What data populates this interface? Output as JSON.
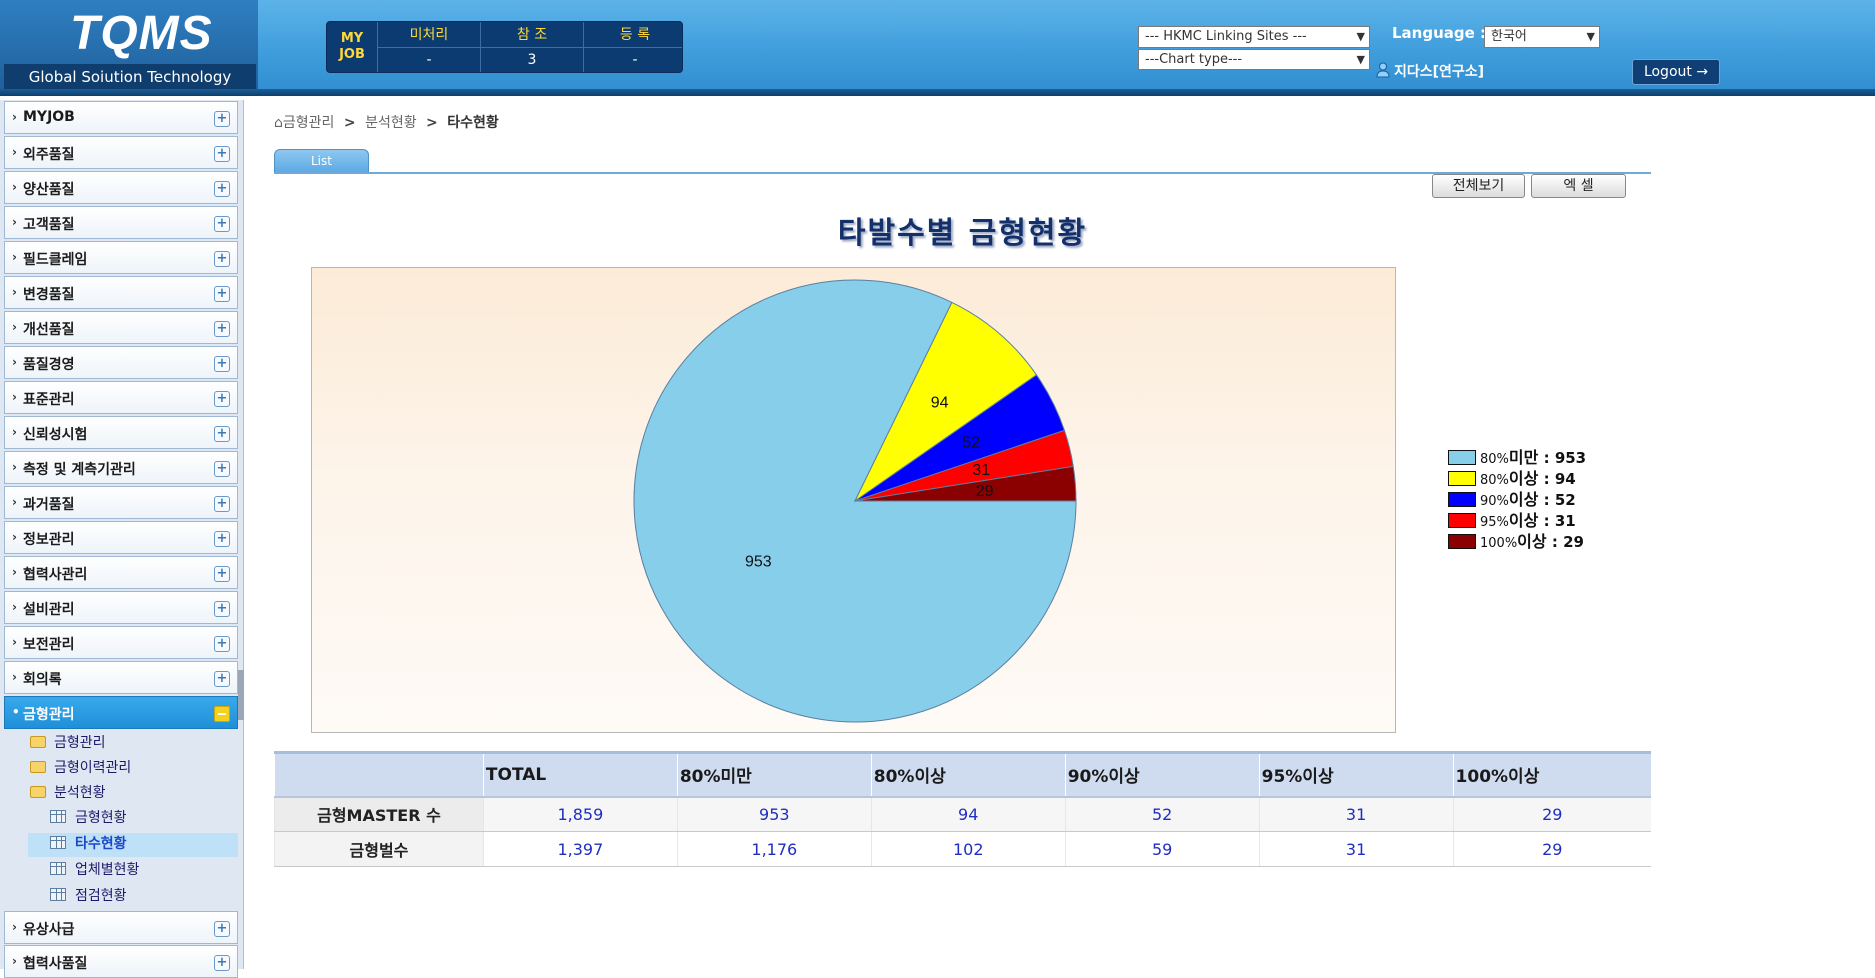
{
  "header": {
    "logo_title": "TQMS",
    "logo_subtitle": "Global Soiution Technology",
    "myjob": {
      "label_line1": "MY",
      "label_line2": "JOB",
      "columns": [
        {
          "title": "미처리",
          "value": "-"
        },
        {
          "title": "참 조",
          "value": "3"
        },
        {
          "title": "등 록",
          "value": "-"
        }
      ]
    },
    "linking_sites_select": "--- HKMC Linking Sites ---",
    "chart_type_select": "---Chart type---",
    "language_label": "Language :",
    "language_value": "한국어",
    "user": "지다스[연구소]",
    "logout_label": "Logout →"
  },
  "sidebar": {
    "items": [
      {
        "label": "MYJOB"
      },
      {
        "label": "외주품질"
      },
      {
        "label": "양산품질"
      },
      {
        "label": "고객품질"
      },
      {
        "label": "필드클레임"
      },
      {
        "label": "변경품질"
      },
      {
        "label": "개선품질"
      },
      {
        "label": "품질경영"
      },
      {
        "label": "표준관리"
      },
      {
        "label": "신뢰성시험"
      },
      {
        "label": "측정 및 계측기관리"
      },
      {
        "label": "과거품질"
      },
      {
        "label": "정보관리"
      },
      {
        "label": "협력사관리"
      },
      {
        "label": "설비관리"
      },
      {
        "label": "보전관리"
      },
      {
        "label": "회의록"
      },
      {
        "label": "금형관리"
      },
      {
        "label": "유상사급"
      },
      {
        "label": "협력사품질"
      }
    ],
    "submenu": {
      "folders": [
        "금형관리",
        "금형이력관리",
        "분석현황"
      ],
      "pages": [
        "금형현황",
        "타수현황",
        "업체별현황",
        "점검현황"
      ]
    }
  },
  "breadcrumb": {
    "home": "금형관리",
    "level2": "분석현황",
    "current": "타수현황",
    "separator": ">"
  },
  "tabs": {
    "list": "List"
  },
  "buttons": {
    "view_all": "전체보기",
    "excel": "엑 셀"
  },
  "chart_data": {
    "type": "pie",
    "title": "타발수별 금형현황",
    "slices": [
      {
        "label": "80%미만",
        "value": 953,
        "color": "#87ceeb"
      },
      {
        "label": "80%이상",
        "value": 94,
        "color": "#ffff00"
      },
      {
        "label": "90%이상",
        "value": 52,
        "color": "#0000ff"
      },
      {
        "label": "95%이상",
        "value": 31,
        "color": "#ff0000"
      },
      {
        "label": "100%이상",
        "value": 29,
        "color": "#8b0000"
      }
    ],
    "legend_position": "right"
  },
  "legend": [
    {
      "pct": "80%",
      "word": "미만",
      "value": "953",
      "color": "#87ceeb"
    },
    {
      "pct": "80%",
      "word": "이상",
      "value": "94",
      "color": "#ffff00"
    },
    {
      "pct": "90%",
      "word": "이상",
      "value": "52",
      "color": "#0000ff"
    },
    {
      "pct": "95%",
      "word": "이상",
      "value": "31",
      "color": "#ff0000"
    },
    {
      "pct": "100%",
      "word": "이상",
      "value": "29",
      "color": "#8b0000"
    }
  ],
  "table": {
    "headers": [
      "",
      "TOTAL",
      "80%미만",
      "80%이상",
      "90%이상",
      "95%이상",
      "100%이상"
    ],
    "rows": [
      [
        "금형MASTER 수",
        "1,859",
        "953",
        "94",
        "52",
        "31",
        "29"
      ],
      [
        "금형벌수",
        "1,397",
        "1,176",
        "102",
        "59",
        "31",
        "29"
      ]
    ]
  }
}
